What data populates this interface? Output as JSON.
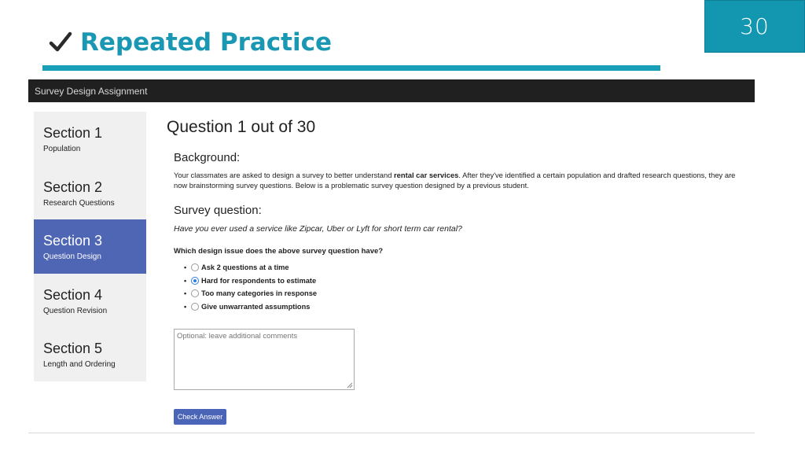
{
  "slide": {
    "number": "30",
    "title": "Repeated Practice",
    "check_icon": "checkmark-icon",
    "colors": {
      "accent": "#1a97b3",
      "number_box": "#1396b0"
    }
  },
  "app": {
    "title": "Survey Design Assignment"
  },
  "sidebar": {
    "items": [
      {
        "title": "Section 1",
        "subtitle": "Population",
        "active": false
      },
      {
        "title": "Section 2",
        "subtitle": "Research Questions",
        "active": false
      },
      {
        "title": "Section 3",
        "subtitle": "Question Design",
        "active": true
      },
      {
        "title": "Section 4",
        "subtitle": "Question Revision",
        "active": false
      },
      {
        "title": "Section 5",
        "subtitle": "Length and Ordering",
        "active": false
      }
    ],
    "active_color": "#4f66b5"
  },
  "main": {
    "heading": "Question 1 out of 30",
    "background_heading": "Background:",
    "background_text_1": "Your classmates are asked to design a survey to better understand ",
    "background_bold": "rental car services",
    "background_text_2": ". After they've identified a certain population and drafted research questions, they are now brainstorming survey questions. Below is a problematic survey question designed by a previous student.",
    "survey_heading": "Survey question:",
    "survey_question": "Have you ever used a service like Zipcar, Uber or Lyft for short term car rental?",
    "prompt": "Which design issue does the above survey question have?",
    "options": [
      {
        "label": "Ask 2 questions at a time",
        "checked": false
      },
      {
        "label": "Hard for respondents to estimate",
        "checked": true
      },
      {
        "label": "Too many categories in response",
        "checked": false
      },
      {
        "label": "Give unwarranted assumptions",
        "checked": false
      }
    ],
    "comments_placeholder": "Optional: leave additional comments",
    "check_button": "Check Answer"
  }
}
